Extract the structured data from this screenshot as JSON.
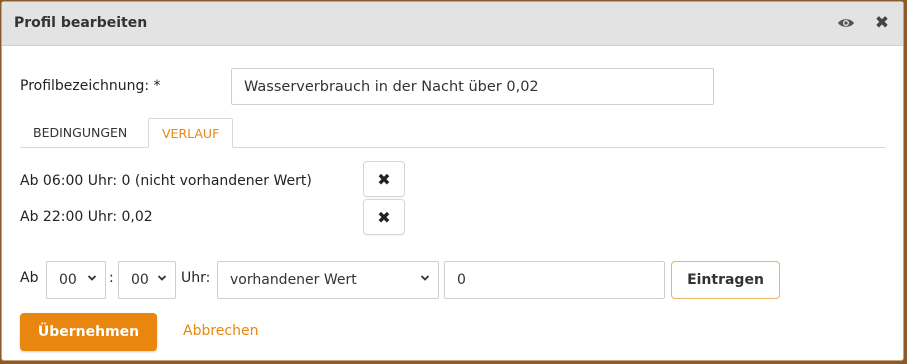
{
  "dialog": {
    "title": "Profil bearbeiten",
    "icons": {
      "eye": "eye-icon",
      "close": "close-icon"
    }
  },
  "form": {
    "profile_label": "Profilbezeichnung: *",
    "profile_value": "Wasserverbrauch in der Nacht über 0,02"
  },
  "tabs": [
    {
      "label": "BEDINGUNGEN",
      "active": false
    },
    {
      "label": "VERLAUF",
      "active": true
    }
  ],
  "entries": [
    {
      "text": "Ab 06:00 Uhr: 0 (nicht vorhandener Wert)"
    },
    {
      "text": "Ab 22:00 Uhr: 0,02"
    }
  ],
  "new_entry": {
    "prefix": "Ab",
    "separator": ":",
    "suffix": "Uhr:",
    "hour": "00",
    "minute": "00",
    "type": "vorhandener Wert",
    "value": "0",
    "add_label": "Eintragen"
  },
  "actions": {
    "apply_label": "Übernehmen",
    "cancel_label": "Abbrechen"
  },
  "colors": {
    "accent": "#e8860f",
    "titlebar": "#e3e3e3"
  }
}
